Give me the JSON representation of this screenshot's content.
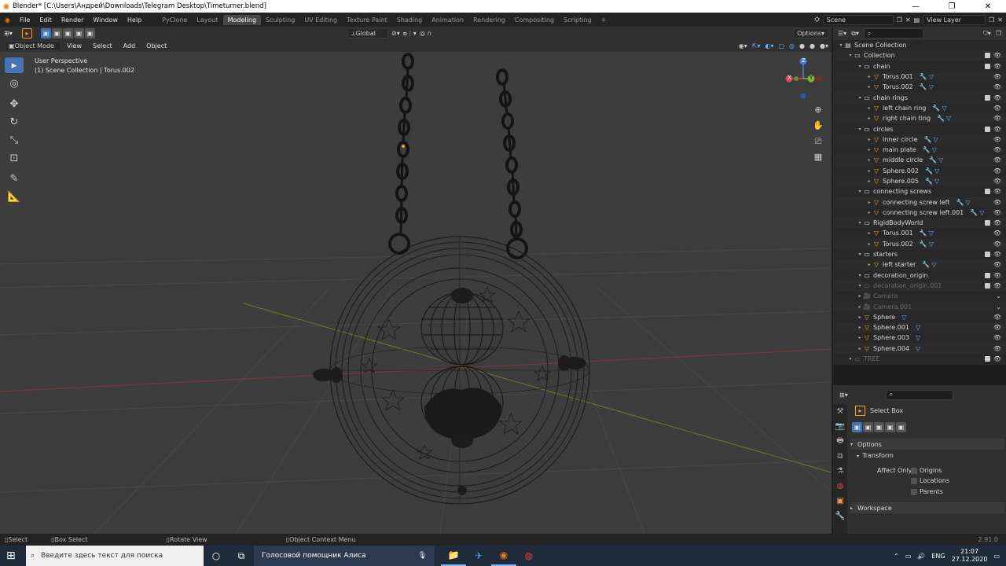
{
  "window": {
    "title": "Blender* [C:\\Users\\Андрей\\Downloads\\Telegram Desktop\\Timeturner.blend]",
    "min": "—",
    "max": "❐",
    "close": "✕"
  },
  "menus": [
    "File",
    "Edit",
    "Render",
    "Window",
    "Help"
  ],
  "workspaces": [
    {
      "label": "PyClone",
      "active": false
    },
    {
      "label": "Layout",
      "active": false
    },
    {
      "label": "Modeling",
      "active": true
    },
    {
      "label": "Sculpting",
      "active": false
    },
    {
      "label": "UV Editing",
      "active": false
    },
    {
      "label": "Texture Paint",
      "active": false
    },
    {
      "label": "Shading",
      "active": false
    },
    {
      "label": "Animation",
      "active": false
    },
    {
      "label": "Rendering",
      "active": false
    },
    {
      "label": "Compositing",
      "active": false
    },
    {
      "label": "Scripting",
      "active": false
    }
  ],
  "add_workspace": "+",
  "scene": {
    "name": "Scene",
    "view_layer": "View Layer"
  },
  "header": {
    "orientation": "Global",
    "options": "Options"
  },
  "viewport_header": {
    "mode": "Object Mode",
    "menus": [
      "View",
      "Select",
      "Add",
      "Object"
    ]
  },
  "viewport_info": {
    "line1": "User Perspective",
    "line2": "(1) Scene Collection | Torus.002"
  },
  "gizmo": {
    "x": "X",
    "y": "Y",
    "z": "Z"
  },
  "outliner": {
    "search_placeholder": "",
    "rows": [
      {
        "label": "Scene Collection",
        "level": 0,
        "type": "scene",
        "mods": ""
      },
      {
        "label": "Collection",
        "level": 1,
        "type": "coll",
        "mods": ""
      },
      {
        "label": "chain",
        "level": 2,
        "type": "coll",
        "mods": ""
      },
      {
        "label": "Torus.001",
        "level": 3,
        "type": "mesh",
        "mods": "🔧▽"
      },
      {
        "label": "Torus.002",
        "level": 3,
        "type": "mesh",
        "mods": "🔧▽"
      },
      {
        "label": "chain rings",
        "level": 2,
        "type": "coll",
        "mods": ""
      },
      {
        "label": "left chain ring",
        "level": 3,
        "type": "mesh",
        "mods": "🔧▽"
      },
      {
        "label": "right chain ting",
        "level": 3,
        "type": "mesh",
        "mods": "🔧▽"
      },
      {
        "label": "circles",
        "level": 2,
        "type": "coll",
        "mods": ""
      },
      {
        "label": "Inner circle",
        "level": 3,
        "type": "mesh",
        "mods": "🔧▽"
      },
      {
        "label": "main plate",
        "level": 3,
        "type": "mesh",
        "mods": "🔧▽"
      },
      {
        "label": "middle circle",
        "level": 3,
        "type": "mesh",
        "mods": "🔧▽"
      },
      {
        "label": "Sphere.002",
        "level": 3,
        "type": "mesh",
        "mods": "🔧▽"
      },
      {
        "label": "Sphere.005",
        "level": 3,
        "type": "mesh",
        "mods": "🔧▽"
      },
      {
        "label": "connecting screws",
        "level": 2,
        "type": "coll",
        "mods": ""
      },
      {
        "label": "connecting screw left",
        "level": 3,
        "type": "mesh",
        "mods": "🔧▽"
      },
      {
        "label": "connecting screw left.001",
        "level": 3,
        "type": "mesh",
        "mods": "🔧▽"
      },
      {
        "label": "RigidBodyWorld",
        "level": 2,
        "type": "coll",
        "mods": ""
      },
      {
        "label": "Torus.001",
        "level": 3,
        "type": "mesh",
        "mods": "🔧▽"
      },
      {
        "label": "Torus.002",
        "level": 3,
        "type": "mesh",
        "mods": "🔧▽"
      },
      {
        "label": "starters",
        "level": 2,
        "type": "coll",
        "mods": ""
      },
      {
        "label": "left starter",
        "level": 3,
        "type": "mesh",
        "mods": "🔧▽"
      },
      {
        "label": "decoration_origin",
        "level": 2,
        "type": "coll",
        "mods": ""
      },
      {
        "label": "decoration_origin.001",
        "level": 2,
        "type": "coll",
        "mods": "",
        "dim": true
      },
      {
        "label": "Camera",
        "level": 2,
        "type": "cam",
        "mods": "",
        "dim": true
      },
      {
        "label": "Camera.001",
        "level": 2,
        "type": "cam",
        "mods": "",
        "dim": true
      },
      {
        "label": "Sphere",
        "level": 2,
        "type": "mesh",
        "mods": "▽"
      },
      {
        "label": "Sphere.001",
        "level": 2,
        "type": "mesh",
        "mods": "▽"
      },
      {
        "label": "Sphere.003",
        "level": 2,
        "type": "mesh",
        "mods": "▽"
      },
      {
        "label": "Sphere.004",
        "level": 2,
        "type": "mesh",
        "mods": "▽"
      },
      {
        "label": "TREE",
        "level": 1,
        "type": "coll",
        "mods": "",
        "dim": true
      }
    ]
  },
  "properties": {
    "tool_name": "Select Box",
    "options_label": "Options",
    "transform_label": "Transform",
    "affect_only": "Affect Only",
    "checks": [
      "Origins",
      "Locations",
      "Parents"
    ],
    "workspace_label": "Workspace"
  },
  "statusbar": {
    "select": "Select",
    "box_select": "Box Select",
    "rotate": "Rotate View",
    "context": "Object Context Menu",
    "version": "2.91.0"
  },
  "taskbar": {
    "search_placeholder": "Введите здесь текст для поиска",
    "assistant": "Голосовой помощник Алиса",
    "lang": "ENG",
    "time": "21:07",
    "date": "27.12.2020"
  }
}
